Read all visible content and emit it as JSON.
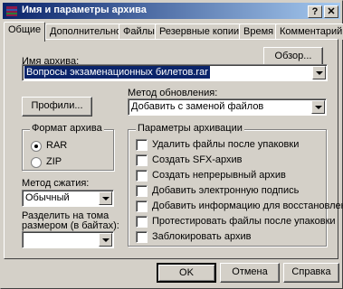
{
  "window": {
    "title": "Имя и параметры архива",
    "help_btn": "?",
    "close_btn": "✕"
  },
  "tabs": [
    {
      "label": "Общие"
    },
    {
      "label": "Дополнительно"
    },
    {
      "label": "Файлы"
    },
    {
      "label": "Резервные копии"
    },
    {
      "label": "Время"
    },
    {
      "label": "Комментарий"
    }
  ],
  "archive_name": {
    "label": "Имя архива:",
    "browse_button": "Обзор...",
    "value": "Вопросы экзаменационных билетов.rar"
  },
  "profiles_button": "Профили...",
  "update_method": {
    "label": "Метод обновления:",
    "value": "Добавить с заменой файлов"
  },
  "archive_format": {
    "title": "Формат архива",
    "options": [
      "RAR",
      "ZIP"
    ],
    "selected": "RAR"
  },
  "compression": {
    "label": "Метод сжатия:",
    "value": "Обычный"
  },
  "split": {
    "label_line1": "Разделить на тома",
    "label_line2": "размером (в байтах):",
    "value": ""
  },
  "options": {
    "title": "Параметры архивации",
    "items": [
      {
        "label": "Удалить файлы после упаковки",
        "checked": false
      },
      {
        "label": "Создать SFX-архив",
        "checked": false
      },
      {
        "label": "Создать непрерывный архив",
        "checked": false
      },
      {
        "label": "Добавить электронную подпись",
        "checked": false
      },
      {
        "label": "Добавить информацию для восстановления",
        "checked": false
      },
      {
        "label": "Протестировать файлы после упаковки",
        "checked": false
      },
      {
        "label": "Заблокировать архив",
        "checked": false
      }
    ]
  },
  "footer": {
    "ok": "OK",
    "cancel": "Отмена",
    "help": "Справка"
  }
}
